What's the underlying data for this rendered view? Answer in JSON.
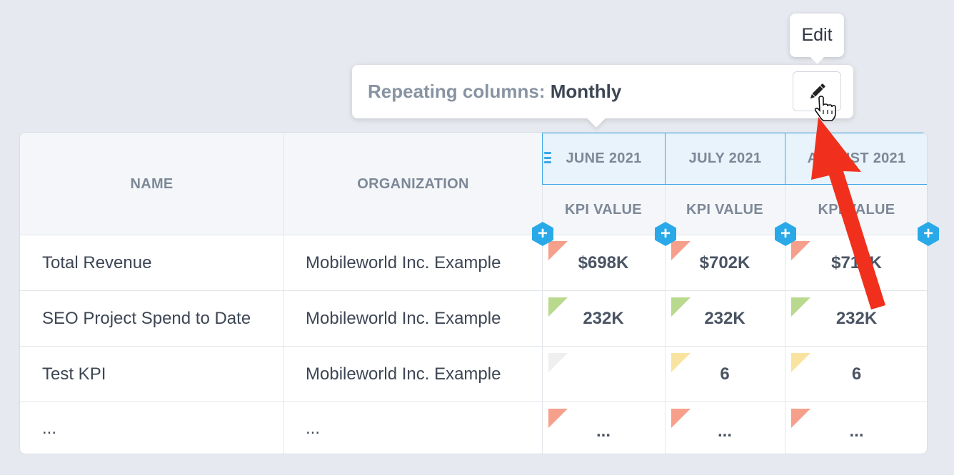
{
  "tooltip": {
    "label": "Edit"
  },
  "repeating": {
    "label": "Repeating columns:",
    "value": "Monthly",
    "edit_icon": "pencil-icon"
  },
  "table": {
    "headers": {
      "name": "NAME",
      "organization": "ORGANIZATION",
      "subheader": "KPI VALUE"
    },
    "months": [
      "JUNE 2021",
      "JULY 2021",
      "AUGUST 2021"
    ],
    "add_symbol": "+",
    "rows": [
      {
        "name": "Total Revenue",
        "org": "Mobileworld Inc. Example",
        "values": [
          "$698K",
          "$702K",
          "$710K"
        ],
        "flags": [
          "red",
          "red",
          "red"
        ]
      },
      {
        "name": "SEO Project Spend to Date",
        "org": "Mobileworld Inc. Example",
        "values": [
          "232K",
          "232K",
          "232K"
        ],
        "flags": [
          "green",
          "green",
          "green"
        ]
      },
      {
        "name": "Test KPI",
        "org": "Mobileworld Inc. Example",
        "values": [
          "",
          "6",
          "6"
        ],
        "flags": [
          "gray",
          "yellow",
          "yellow"
        ]
      },
      {
        "name": "...",
        "org": "...",
        "values": [
          "...",
          "...",
          "..."
        ],
        "flags": [
          "red",
          "red",
          "red"
        ]
      }
    ]
  },
  "colors": {
    "accent": "#29a9e8",
    "flag_red": "#f6a08c",
    "flag_green": "#b8d98e",
    "flag_yellow": "#f9e3a0",
    "flag_gray": "#efefef",
    "annotation_arrow": "#f0301c"
  }
}
